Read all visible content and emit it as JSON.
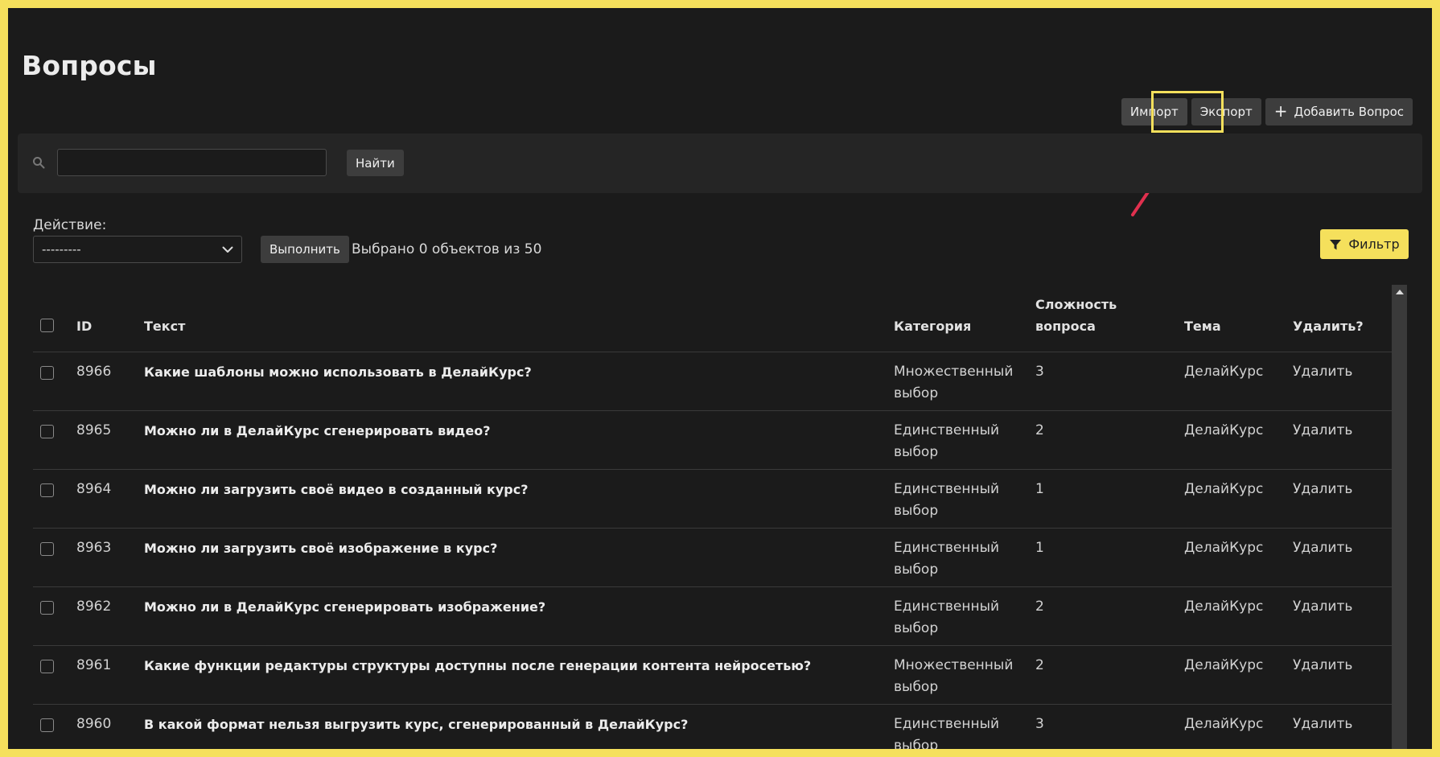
{
  "page": {
    "title": "Вопросы"
  },
  "toolbar": {
    "import_label": "Импорт",
    "export_label": "Экспорт",
    "add_label": "Добавить Вопрос"
  },
  "search": {
    "value": "",
    "placeholder": "",
    "button_label": "Найти"
  },
  "actions": {
    "label": "Действие:",
    "selected_value": "---------",
    "execute_label": "Выполнить",
    "selected_text": "Выбрано 0 объектов из 50"
  },
  "filter": {
    "label": "Фильтр"
  },
  "table": {
    "headers": {
      "id": "ID",
      "text": "Текст",
      "category": "Категория",
      "difficulty_line1": "Сложность",
      "difficulty_line2": "вопроса",
      "topic": "Тема",
      "delete": "Удалить?"
    },
    "rows": [
      {
        "id": "8966",
        "text": "Какие шаблоны можно использовать в ДелайКурс?",
        "category_line1": "Множественный",
        "category_line2": "выбор",
        "difficulty": "3",
        "topic": "ДелайКурс",
        "delete": "Удалить"
      },
      {
        "id": "8965",
        "text": "Можно ли в ДелайКурс сгенерировать видео?",
        "category_line1": "Единственный",
        "category_line2": "выбор",
        "difficulty": "2",
        "topic": "ДелайКурс",
        "delete": "Удалить"
      },
      {
        "id": "8964",
        "text": "Можно ли загрузить своё видео в созданный курс?",
        "category_line1": "Единственный",
        "category_line2": "выбор",
        "difficulty": "1",
        "topic": "ДелайКурс",
        "delete": "Удалить"
      },
      {
        "id": "8963",
        "text": "Можно ли загрузить своё изображение в курс?",
        "category_line1": "Единственный",
        "category_line2": "выбор",
        "difficulty": "1",
        "topic": "ДелайКурс",
        "delete": "Удалить"
      },
      {
        "id": "8962",
        "text": "Можно ли в ДелайКурс сгенерировать изображение?",
        "category_line1": "Единственный",
        "category_line2": "выбор",
        "difficulty": "2",
        "topic": "ДелайКурс",
        "delete": "Удалить"
      },
      {
        "id": "8961",
        "text": "Какие функции редактуры структуры доступны после генерации контента нейросетью?",
        "category_line1": "Множественный",
        "category_line2": "выбор",
        "difficulty": "2",
        "topic": "ДелайКурс",
        "delete": "Удалить"
      },
      {
        "id": "8960",
        "text": "В какой формат нельзя выгрузить курс, сгенерированный в ДелайКурс?",
        "category_line1": "Единственный",
        "category_line2": "выбор",
        "difficulty": "3",
        "topic": "ДелайКурс",
        "delete": "Удалить"
      }
    ]
  },
  "colors": {
    "accent": "#f5e05c",
    "background": "#1b1b1b",
    "arrow": "#e0304e"
  },
  "icons": {
    "search": "search-icon",
    "filter": "filter-icon",
    "plus": "plus-icon",
    "chevron": "chevron-down-icon",
    "arrow": "arrow-annotation-icon"
  }
}
